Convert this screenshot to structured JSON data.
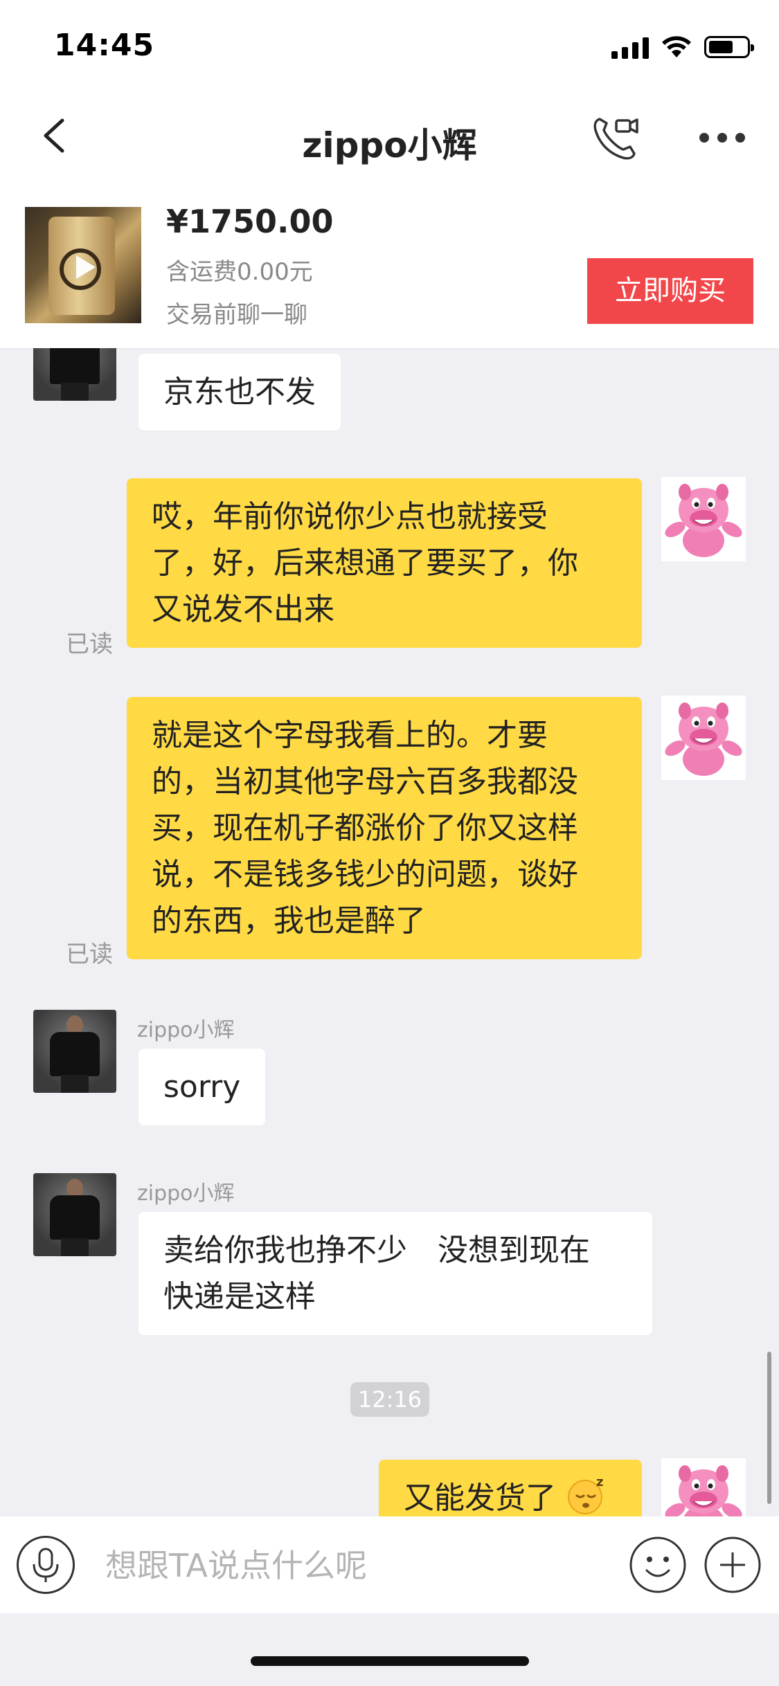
{
  "status_bar": {
    "time": "14:45"
  },
  "nav": {
    "title": "zippo小辉"
  },
  "product": {
    "price": "¥1750.00",
    "shipping": "含运费0.00元",
    "note": "交易前聊一聊",
    "buy_label": "立即购买"
  },
  "messages": [
    {
      "side": "in",
      "sender": "",
      "text": "京东也不发"
    },
    {
      "side": "out",
      "read": "已读",
      "lines": [
        "哎，年前你说你少点也就接受",
        "了，好，后来想通了要买了，你",
        "又说发不出来"
      ]
    },
    {
      "side": "out",
      "read": "已读",
      "lines": [
        "就是这个字母我看上的。才要",
        "的，当初其他字母六百多我都没",
        "买，现在机子都涨价了你又这样",
        "说，不是钱多钱少的问题，谈好",
        "的东西，我也是醉了"
      ]
    },
    {
      "side": "in",
      "sender": "zippo小辉",
      "text": "sorry"
    },
    {
      "side": "in",
      "sender": "zippo小辉",
      "lines": [
        "卖给你我也挣不少　没想到现在",
        "快递是这样"
      ]
    },
    {
      "timestamp": "12:16"
    },
    {
      "side": "out",
      "text": "又能发货了"
    }
  ],
  "input": {
    "placeholder": "想跟TA说点什么呢"
  },
  "colors": {
    "outgoing_bubble": "#ffda44",
    "buy_button": "#f2474a",
    "background": "#efeff4"
  },
  "icons": [
    "back-arrow-icon",
    "video-call-icon",
    "more-icon",
    "play-icon",
    "microphone-icon",
    "emoji-icon",
    "plus-icon"
  ]
}
